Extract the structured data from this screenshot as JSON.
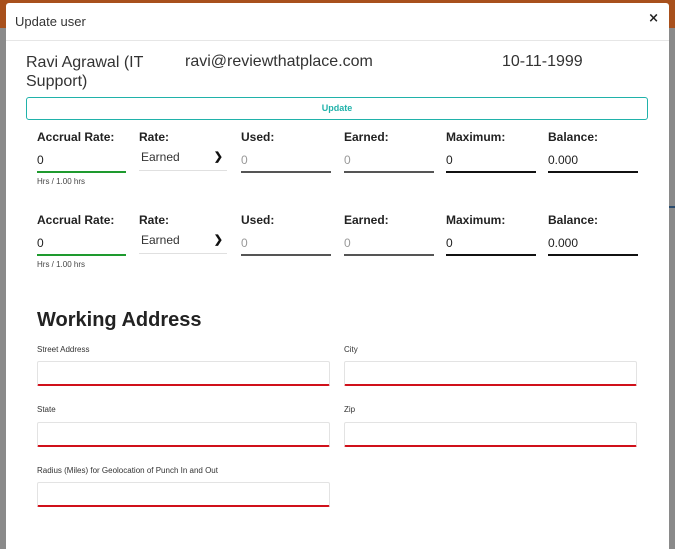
{
  "modal": {
    "title": "Update user",
    "close_glyph": "×"
  },
  "user": {
    "name": "Ravi Agrawal (IT Support)",
    "email": "ravi@reviewthatplace.com",
    "date": "10-11-1999"
  },
  "update_label": "Update",
  "columns": {
    "accrual_rate": "Accrual Rate:",
    "rate": "Rate:",
    "used": "Used:",
    "earned": "Earned:",
    "maximum": "Maximum:",
    "balance": "Balance:"
  },
  "accruals": [
    {
      "accrual_rate": "0",
      "hint": "Hrs / 1.00 hrs",
      "rate": "Earned",
      "used": "0",
      "earned": "0",
      "maximum": "0",
      "balance": "0.000"
    },
    {
      "accrual_rate": "0",
      "hint": "Hrs / 1.00 hrs",
      "rate": "Earned",
      "used": "0",
      "earned": "0",
      "maximum": "0",
      "balance": "0.000"
    }
  ],
  "address": {
    "section_title": "Working Address",
    "street_label": "Street Address",
    "city_label": "City",
    "state_label": "State",
    "zip_label": "Zip",
    "radius_label": "Radius (Miles) for Geolocation of Punch In and Out",
    "street_value": "",
    "city_value": "",
    "state_value": "",
    "zip_value": "",
    "radius_value": ""
  },
  "icons": {
    "close": "close-icon",
    "chevron": "chevron-down-icon"
  },
  "colors": {
    "accent_teal": "#20b2aa",
    "valid_green": "#1e9a2e",
    "error_red": "#d0101a",
    "header_orange": "#a8501c"
  }
}
